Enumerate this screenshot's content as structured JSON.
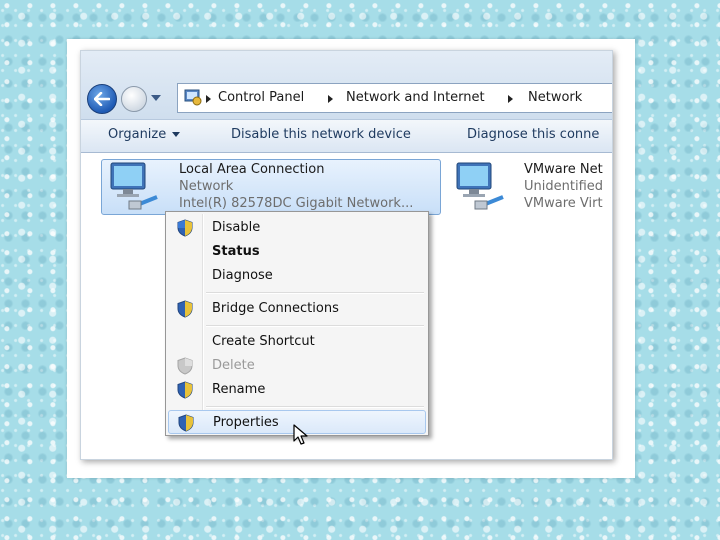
{
  "address_bar": {
    "crumbs": [
      "Control Panel",
      "Network and Internet",
      "Network"
    ]
  },
  "command_bar": {
    "organize_label": "Organize",
    "disable_label": "Disable this network device",
    "diagnose_label": "Diagnose this conne"
  },
  "items": [
    {
      "name": "Local Area Connection",
      "status": "Network",
      "device": "Intel(R) 82578DC Gigabit Network..."
    },
    {
      "name": "VMware Net",
      "status": "Unidentified",
      "device": "VMware Virt"
    }
  ],
  "context_menu": {
    "items": [
      {
        "label": "Disable",
        "icon": "uac-shield-icon"
      },
      {
        "label": "Status",
        "bold": true
      },
      {
        "label": "Diagnose"
      },
      {
        "label": "Bridge Connections",
        "icon": "uac-shield-icon"
      },
      {
        "label": "Create Shortcut"
      },
      {
        "label": "Delete",
        "icon": "uac-shield-icon",
        "disabled": true
      },
      {
        "label": "Rename",
        "icon": "uac-shield-icon"
      },
      {
        "label": "Properties",
        "icon": "uac-shield-icon",
        "highlighted": true
      }
    ]
  },
  "colors": {
    "background": "#a6dde8",
    "command_text": "#1e3a5f",
    "selection": "#c8dff8"
  }
}
